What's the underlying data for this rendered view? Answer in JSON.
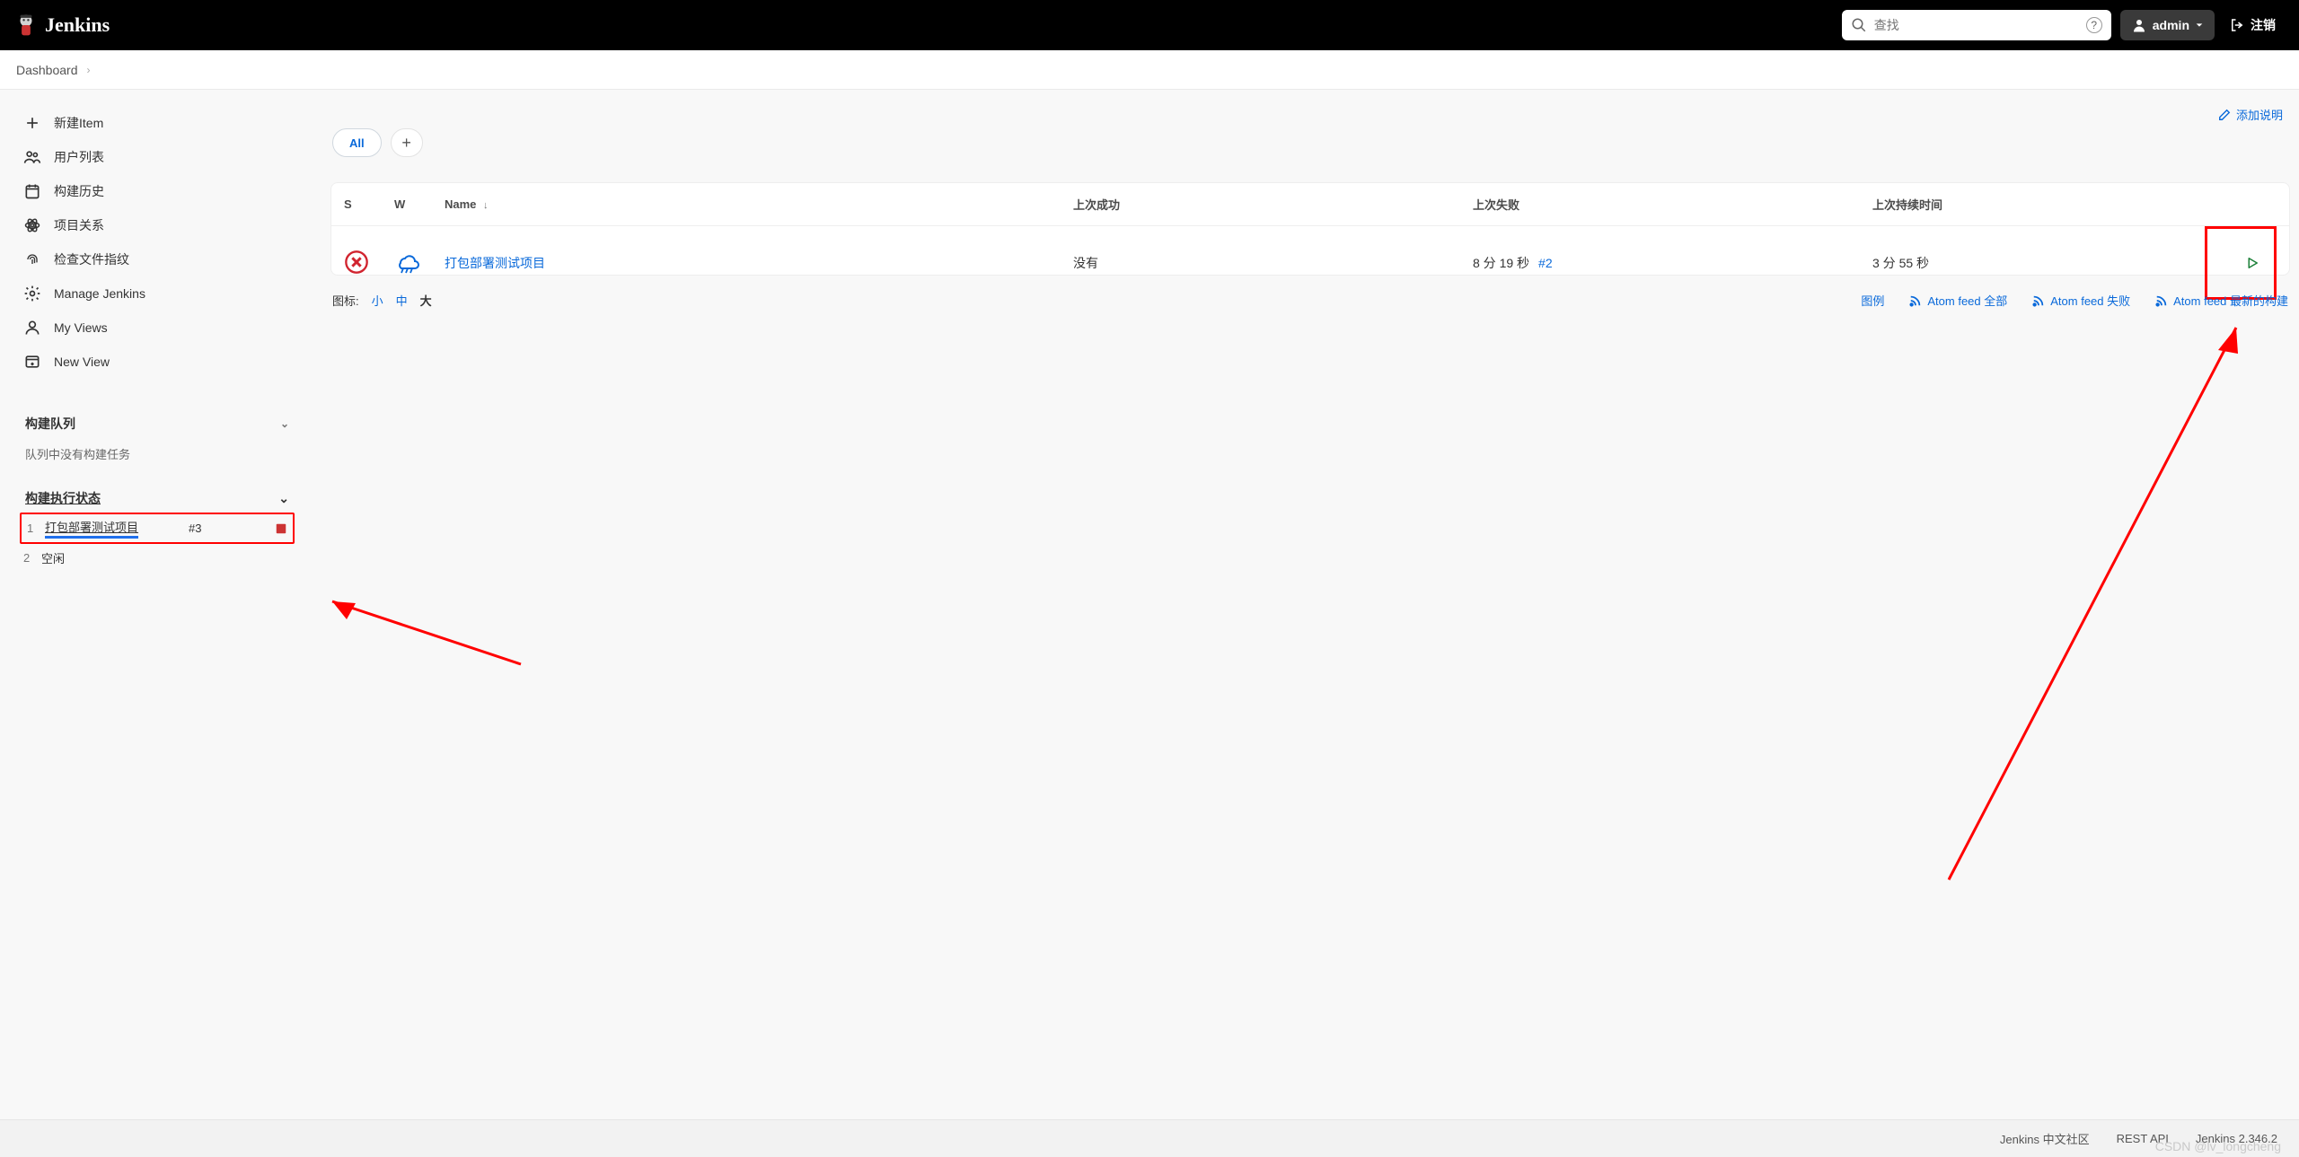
{
  "header": {
    "brand": "Jenkins",
    "search_placeholder": "查找",
    "user": "admin",
    "logout": "注销"
  },
  "breadcrumb": {
    "dashboard": "Dashboard"
  },
  "sidebar": {
    "nav": [
      {
        "key": "new-item",
        "label": "新建Item",
        "icon": "plus-icon"
      },
      {
        "key": "people",
        "label": "用户列表",
        "icon": "people-icon"
      },
      {
        "key": "build-history",
        "label": "构建历史",
        "icon": "history-icon"
      },
      {
        "key": "project-rel",
        "label": "项目关系",
        "icon": "atom-icon"
      },
      {
        "key": "fingerprint",
        "label": "检查文件指纹",
        "icon": "fingerprint-icon"
      },
      {
        "key": "manage",
        "label": "Manage Jenkins",
        "icon": "gear-icon"
      },
      {
        "key": "my-views",
        "label": "My Views",
        "icon": "user-icon"
      },
      {
        "key": "new-view",
        "label": "New View",
        "icon": "new-window-icon"
      }
    ],
    "build_queue": {
      "title": "构建队列",
      "empty": "队列中没有构建任务"
    },
    "executors": {
      "title": "构建执行状态",
      "items": [
        {
          "index": "1",
          "job": "打包部署测试项目",
          "build": "#3",
          "running": true,
          "highlight": true
        },
        {
          "index": "2",
          "label": "空闲",
          "running": false
        }
      ]
    }
  },
  "main": {
    "add_description": "添加说明",
    "tabs": {
      "all": "All"
    },
    "table": {
      "headers": {
        "s": "S",
        "w": "W",
        "name": "Name",
        "sort": "↓",
        "last_success": "上次成功",
        "last_failure": "上次失败",
        "last_duration": "上次持续时间"
      },
      "rows": [
        {
          "name": "打包部署测试项目",
          "last_success": "没有",
          "last_failure_time": "8 分 19 秒",
          "last_failure_build": "#2",
          "last_duration": "3 分 55 秒"
        }
      ]
    },
    "icon_sizes": {
      "label": "图标:",
      "s": "小",
      "m": "中",
      "l": "大"
    },
    "feeds": {
      "legend": "图例",
      "all": "Atom feed 全部",
      "failed": "Atom feed 失败",
      "latest": "Atom feed 最新的构建"
    }
  },
  "footer": {
    "zh_community": "Jenkins 中文社区",
    "rest_api": "REST API",
    "version": "Jenkins 2.346.2"
  },
  "watermark": "CSDN @lv_longcheng"
}
